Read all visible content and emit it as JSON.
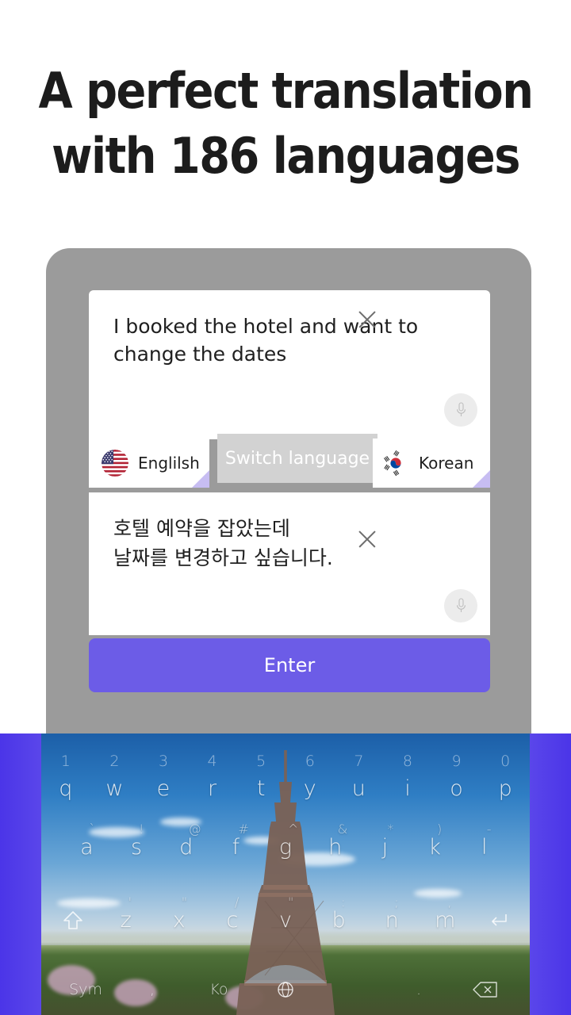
{
  "headline": {
    "line1": "A perfect translation",
    "line2": "with 186 languages"
  },
  "colors": {
    "accent_purple": "#6c5ce7",
    "band_purple": "#4b35e8",
    "phone_gray": "#9b9b9b",
    "switch_gray": "#d2d2d2",
    "corner_triangle": "#c7bdf2",
    "text_dark": "#1f1f1f"
  },
  "translator": {
    "source": {
      "text": "I booked the hotel and want to change the dates",
      "close_label": "×",
      "mic_label": "microphone"
    },
    "target": {
      "text_line1": "호텔 예약을 잡았는데",
      "text_line2": "날짜를 변경하고 싶습니다.",
      "close_label": "×",
      "mic_label": "microphone"
    },
    "language_bar": {
      "source_language": "Englilsh",
      "source_flag": "us-flag-icon",
      "target_language": "Korean",
      "target_flag": "kr-flag-icon",
      "switch_label": "Switch language"
    },
    "enter_label": "Enter"
  },
  "keyboard": {
    "number_row": [
      "1",
      "2",
      "3",
      "4",
      "5",
      "6",
      "7",
      "8",
      "9",
      "0"
    ],
    "row1": [
      "q",
      "w",
      "e",
      "r",
      "t",
      "y",
      "u",
      "i",
      "o",
      "p"
    ],
    "row2": [
      "a",
      "s",
      "d",
      "f",
      "g",
      "h",
      "j",
      "k",
      "l"
    ],
    "row2_sup": [
      "`",
      "!",
      "@",
      "#",
      "_",
      "^",
      "&",
      "*",
      ")",
      "-"
    ],
    "row3": [
      "z",
      "x",
      "c",
      "v",
      "b",
      "n",
      "m"
    ],
    "row3_sup": [
      "'",
      "\"",
      "/",
      "\"",
      ":",
      ";",
      ","
    ],
    "shift_label": "shift-arrow-icon",
    "enter_key_label": "return-arrow-icon",
    "bottom_row": [
      "Sym",
      ",",
      "Ko",
      "space",
      ".",
      "backspace"
    ],
    "sym_label": "Sym",
    "lang_label": "Ko",
    "backspace_label": "backspace-icon",
    "globe_label": "globe-icon"
  }
}
